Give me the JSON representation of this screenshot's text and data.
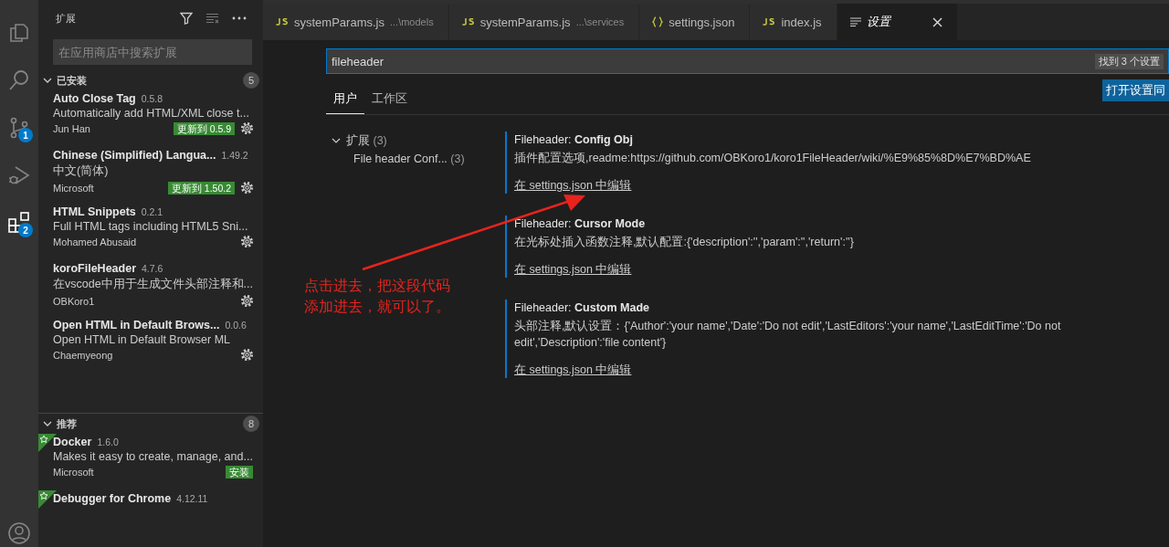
{
  "activity_bar": {
    "items": [
      {
        "kind": "explorer",
        "selected": false
      },
      {
        "kind": "search",
        "selected": false
      },
      {
        "kind": "scm",
        "selected": false,
        "badge": "1"
      },
      {
        "kind": "debug",
        "selected": false
      },
      {
        "kind": "extensions",
        "selected": true,
        "badge": "2"
      }
    ]
  },
  "sidebar": {
    "title": "扩展",
    "search": {
      "placeholder": "在应用商店中搜索扩展"
    },
    "sections": [
      {
        "title": "已安装",
        "count": "5",
        "expanded": true,
        "items": [
          {
            "name": "Auto Close Tag",
            "version": "0.5.8",
            "description": "Automatically add HTML/XML close t...",
            "publisher": "Jun Han",
            "action": {
              "kind": "update",
              "label": "更新到 0.5.9"
            },
            "gear": true,
            "starred": false
          },
          {
            "name": "Chinese (Simplified) Langua...",
            "version": "1.49.2",
            "description": "中文(简体)",
            "publisher": "Microsoft",
            "action": {
              "kind": "update",
              "label": "更新到 1.50.2"
            },
            "gear": true,
            "starred": false
          },
          {
            "name": "HTML Snippets",
            "version": "0.2.1",
            "description": "Full HTML tags including HTML5 Sni...",
            "publisher": "Mohamed Abusaid",
            "gear": true,
            "starred": false
          },
          {
            "name": "koroFileHeader",
            "version": "4.7.6",
            "description": "在vscode中用于生成文件头部注释和...",
            "publisher": "OBKoro1",
            "gear": true,
            "starred": false
          },
          {
            "name": "Open HTML in Default Brows...",
            "version": "0.0.6",
            "description": "Open HTML in Default Browser ML",
            "publisher": "Chaemyeong",
            "gear": true,
            "starred": false
          }
        ]
      },
      {
        "title": "推荐",
        "count": "8",
        "expanded": true,
        "items": [
          {
            "name": "Docker",
            "version": "1.6.0",
            "description": "Makes it easy to create, manage, and...",
            "publisher": "Microsoft",
            "action": {
              "kind": "install",
              "label": "安装"
            },
            "gear": false,
            "starred": true
          },
          {
            "name": "Debugger for Chrome",
            "version": "4.12.11",
            "starred": true
          }
        ]
      }
    ]
  },
  "tabs": [
    {
      "kind": "js",
      "label": "systemParams.js",
      "path": "...\\models",
      "selected": false
    },
    {
      "kind": "js",
      "label": "systemParams.js",
      "path": "...\\services",
      "selected": false
    },
    {
      "kind": "json",
      "label": "settings.json",
      "selected": false
    },
    {
      "kind": "js",
      "label": "index.js",
      "selected": false
    },
    {
      "kind": "settings",
      "label": "设置",
      "selected": true
    }
  ],
  "settings_editor": {
    "search": {
      "value": "fileheader"
    },
    "result_count": "找到 3 个设置",
    "scope_tabs": [
      {
        "label": "用户",
        "selected": true
      },
      {
        "label": "工作区",
        "selected": false
      }
    ],
    "sync_button": "打开设置同",
    "toc": [
      {
        "label": "扩展",
        "count": "(3)",
        "expanded": true,
        "children": [
          {
            "label": "File header Conf...",
            "count": "(3)"
          }
        ]
      }
    ],
    "settings": [
      {
        "category": "Fileheader: ",
        "name": "Config Obj",
        "description": "插件配置选项,readme:https://github.com/OBKoro1/koro1FileHeader/wiki/%E9%85%8D%E7%BD%AE",
        "link": "在 settings.json 中编辑"
      },
      {
        "category": "Fileheader: ",
        "name": "Cursor Mode",
        "description": "在光标处插入函数注释,默认配置:{'description':'','param':'','return':''}",
        "link": "在 settings.json 中编辑"
      },
      {
        "category": "Fileheader: ",
        "name": "Custom Made",
        "description": "头部注释,默认设置：{'Author':'your name','Date':'Do not edit','LastEditors':'your name','LastEditTime':'Do not edit','Description':'file content'}",
        "link": "在 settings.json 中编辑"
      }
    ]
  },
  "annotation": {
    "lines": [
      "点击进去，把这段代码",
      "添加进去，就可以了。"
    ]
  }
}
